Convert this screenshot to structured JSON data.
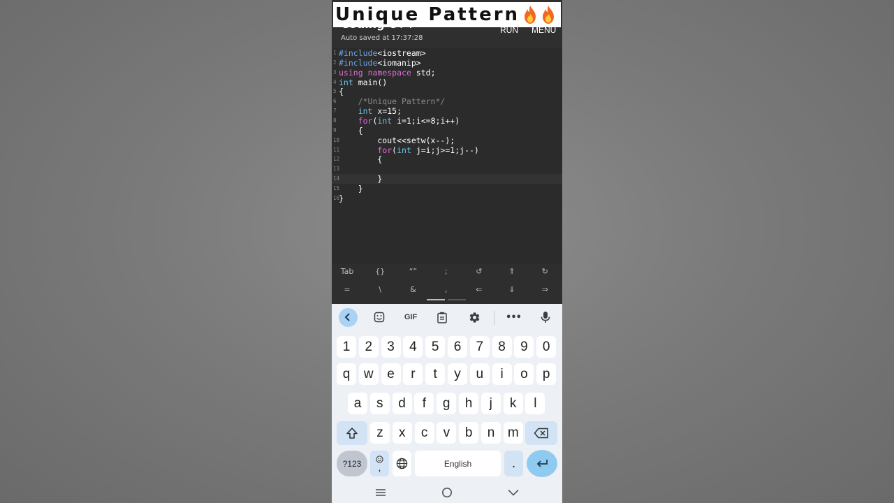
{
  "overlay": {
    "title": "Unique Pattern"
  },
  "app": {
    "title": "Coding C++",
    "autosave": "Auto saved at 17:37:28",
    "run_label": "RUN",
    "menu_label": "MENU"
  },
  "editor": {
    "line_numbers": [
      "1",
      "2",
      "3",
      "4",
      "5",
      "6",
      "7",
      "8",
      "9",
      "10",
      "11",
      "12",
      "13",
      "14",
      "15",
      "16"
    ],
    "lines": [
      [
        {
          "t": "#include",
          "c": "c-pp"
        },
        {
          "t": "<iostream>",
          "c": "c-str"
        }
      ],
      [
        {
          "t": "#include",
          "c": "c-pp"
        },
        {
          "t": "<iomanip>",
          "c": "c-str"
        }
      ],
      [
        {
          "t": "using",
          "c": "c-kw"
        },
        {
          "t": " ",
          "c": "c-def"
        },
        {
          "t": "namespace",
          "c": "c-kw"
        },
        {
          "t": " std;",
          "c": "c-def"
        }
      ],
      [
        {
          "t": "int",
          "c": "c-type"
        },
        {
          "t": " main()",
          "c": "c-def"
        }
      ],
      [
        {
          "t": "{",
          "c": "c-def"
        }
      ],
      [
        {
          "t": "    /*Unique Pattern*/",
          "c": "c-cm"
        }
      ],
      [
        {
          "t": "    ",
          "c": "c-def"
        },
        {
          "t": "int",
          "c": "c-type"
        },
        {
          "t": " x=15;",
          "c": "c-def"
        }
      ],
      [
        {
          "t": "    ",
          "c": "c-def"
        },
        {
          "t": "for",
          "c": "c-kw"
        },
        {
          "t": "(",
          "c": "c-def"
        },
        {
          "t": "int",
          "c": "c-type"
        },
        {
          "t": " i=1;i<=8;i++)",
          "c": "c-def"
        }
      ],
      [
        {
          "t": "    {",
          "c": "c-def"
        }
      ],
      [
        {
          "t": "        cout<<setw(x--);",
          "c": "c-def"
        }
      ],
      [
        {
          "t": "        ",
          "c": "c-def"
        },
        {
          "t": "for",
          "c": "c-kw"
        },
        {
          "t": "(",
          "c": "c-def"
        },
        {
          "t": "int",
          "c": "c-type"
        },
        {
          "t": " j=i;j>=1;j--)",
          "c": "c-def"
        }
      ],
      [
        {
          "t": "        {",
          "c": "c-def"
        }
      ],
      [],
      [
        {
          "t": "        }",
          "c": "c-def"
        }
      ],
      [
        {
          "t": "    }",
          "c": "c-def"
        }
      ],
      [
        {
          "t": "}",
          "c": "c-def"
        }
      ]
    ],
    "active_line": 14
  },
  "symbol_bar": {
    "row1": [
      "Tab",
      "{}",
      "“”",
      ";",
      "↺",
      "⇑",
      "↻"
    ],
    "row2": [
      "=",
      "\\",
      "&",
      ",",
      "⇐",
      "⇓",
      "⇒"
    ]
  },
  "keyboard": {
    "toolbar": [
      "back-icon",
      "sticker-icon",
      "GIF",
      "clipboard-icon",
      "settings-icon",
      "more-icon",
      "mic-icon"
    ],
    "gif_label": "GIF",
    "more_label": "•••",
    "digits": [
      "1",
      "2",
      "3",
      "4",
      "5",
      "6",
      "7",
      "8",
      "9",
      "0"
    ],
    "row1": [
      "q",
      "w",
      "e",
      "r",
      "t",
      "y",
      "u",
      "i",
      "o",
      "p"
    ],
    "row2": [
      "a",
      "s",
      "d",
      "f",
      "g",
      "h",
      "j",
      "k",
      "l"
    ],
    "row3": [
      "z",
      "x",
      "c",
      "v",
      "b",
      "n",
      "m"
    ],
    "symbols_key": "?123",
    "emoji_comma": ",",
    "space_label": "English",
    "period": ".",
    "colors": {
      "accent": "#8fcaf0",
      "special": "#d1e3f5",
      "background": "#edf0f5"
    }
  },
  "navbar": [
    "recents-icon",
    "home-icon",
    "back-chevron-icon"
  ]
}
